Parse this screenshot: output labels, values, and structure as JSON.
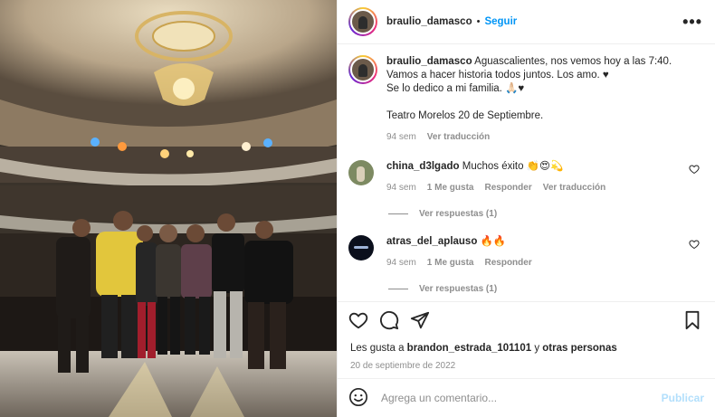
{
  "header": {
    "username": "braulio_damasco",
    "separator": "•",
    "follow_label": "Seguir",
    "more_label": "•••"
  },
  "caption": {
    "username": "braulio_damasco",
    "text_line1": "Aguascalientes, nos vemos hoy a las 7:40.",
    "text_line2": "Vamos a hacer historia todos juntos. Los amo. ♥",
    "text_line3": "Se lo dedico a mi familia. 🙏🏻♥",
    "text_line4": "Teatro Morelos 20 de Septiembre.",
    "time": "94 sem",
    "translate": "Ver traducción"
  },
  "comments": [
    {
      "username": "china_d3lgado",
      "text": "Muchos éxito 👏😍💫",
      "time": "94 sem",
      "likes": "1 Me gusta",
      "reply": "Responder",
      "translate": "Ver traducción",
      "replies": "Ver respuestas (1)"
    },
    {
      "username": "atras_del_aplauso",
      "text": "🔥🔥",
      "time": "94 sem",
      "likes": "1 Me gusta",
      "reply": "Responder",
      "replies": "Ver respuestas (1)"
    }
  ],
  "likes": {
    "prefix": "Les gusta a",
    "user": "brandon_estrada_101101",
    "middle": "y",
    "others": "otras personas"
  },
  "date": "20 de septiembre de 2022",
  "add_comment": {
    "placeholder": "Agrega un comentario...",
    "publish": "Publicar"
  },
  "icons": {
    "like": "heart-outline-icon",
    "comment": "comment-bubble-icon",
    "share": "paper-plane-icon",
    "save": "bookmark-icon",
    "emoji": "smiley-icon"
  },
  "colors": {
    "accent": "#0095f6",
    "publish_disabled": "#b2dffc",
    "muted": "#8e8e8e",
    "text": "#262626"
  }
}
